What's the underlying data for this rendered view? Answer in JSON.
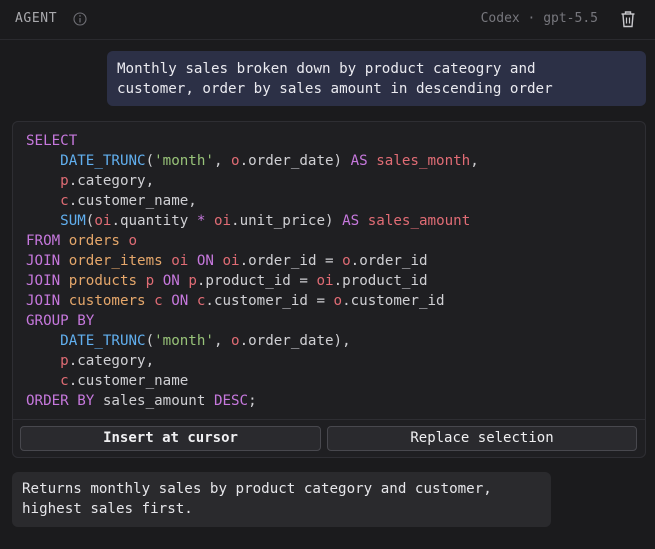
{
  "header": {
    "title": "AGENT",
    "info_icon": "info-circle-icon",
    "model": "Codex · gpt-5.5",
    "delete_icon": "trash-icon"
  },
  "user_message": "Monthly sales broken down by product cateogry and\ncustomer, order by sales amount in descending order",
  "code": {
    "language": "sql",
    "lines": [
      [
        [
          "kw",
          "SELECT"
        ]
      ],
      [
        [
          "sp",
          "    "
        ],
        [
          "fn",
          "DATE_TRUNC"
        ],
        [
          "ident",
          "("
        ],
        [
          "str",
          "'month'"
        ],
        [
          "ident",
          ", "
        ],
        [
          "al",
          "o"
        ],
        [
          "ident",
          ".order_date) "
        ],
        [
          "kw",
          "AS"
        ],
        [
          "ident",
          " "
        ],
        [
          "al",
          "sales_month"
        ],
        [
          "ident",
          ","
        ]
      ],
      [
        [
          "sp",
          "    "
        ],
        [
          "al",
          "p"
        ],
        [
          "ident",
          ".category,"
        ]
      ],
      [
        [
          "sp",
          "    "
        ],
        [
          "al",
          "c"
        ],
        [
          "ident",
          ".customer_name,"
        ]
      ],
      [
        [
          "sp",
          "    "
        ],
        [
          "fn",
          "SUM"
        ],
        [
          "ident",
          "("
        ],
        [
          "al",
          "oi"
        ],
        [
          "ident",
          ".quantity "
        ],
        [
          "kw",
          "*"
        ],
        [
          "ident",
          " "
        ],
        [
          "al",
          "oi"
        ],
        [
          "ident",
          ".unit_price) "
        ],
        [
          "kw",
          "AS"
        ],
        [
          "ident",
          " "
        ],
        [
          "al",
          "sales_amount"
        ]
      ],
      [
        [
          "kw",
          "FROM"
        ],
        [
          "ident",
          " "
        ],
        [
          "tb",
          "orders"
        ],
        [
          "ident",
          " "
        ],
        [
          "al",
          "o"
        ]
      ],
      [
        [
          "kw",
          "JOIN"
        ],
        [
          "ident",
          " "
        ],
        [
          "tb",
          "order_items"
        ],
        [
          "ident",
          " "
        ],
        [
          "al",
          "oi"
        ],
        [
          "ident",
          " "
        ],
        [
          "kw",
          "ON"
        ],
        [
          "ident",
          " "
        ],
        [
          "al",
          "oi"
        ],
        [
          "ident",
          ".order_id = "
        ],
        [
          "al",
          "o"
        ],
        [
          "ident",
          ".order_id"
        ]
      ],
      [
        [
          "kw",
          "JOIN"
        ],
        [
          "ident",
          " "
        ],
        [
          "tb",
          "products"
        ],
        [
          "ident",
          " "
        ],
        [
          "al",
          "p"
        ],
        [
          "ident",
          " "
        ],
        [
          "kw",
          "ON"
        ],
        [
          "ident",
          " "
        ],
        [
          "al",
          "p"
        ],
        [
          "ident",
          ".product_id = "
        ],
        [
          "al",
          "oi"
        ],
        [
          "ident",
          ".product_id"
        ]
      ],
      [
        [
          "kw",
          "JOIN"
        ],
        [
          "ident",
          " "
        ],
        [
          "tb",
          "customers"
        ],
        [
          "ident",
          " "
        ],
        [
          "al",
          "c"
        ],
        [
          "ident",
          " "
        ],
        [
          "kw",
          "ON"
        ],
        [
          "ident",
          " "
        ],
        [
          "al",
          "c"
        ],
        [
          "ident",
          ".customer_id = "
        ],
        [
          "al",
          "o"
        ],
        [
          "ident",
          ".customer_id"
        ]
      ],
      [
        [
          "kw",
          "GROUP BY"
        ]
      ],
      [
        [
          "sp",
          "    "
        ],
        [
          "fn",
          "DATE_TRUNC"
        ],
        [
          "ident",
          "("
        ],
        [
          "str",
          "'month'"
        ],
        [
          "ident",
          ", "
        ],
        [
          "al",
          "o"
        ],
        [
          "ident",
          ".order_date),"
        ]
      ],
      [
        [
          "sp",
          "    "
        ],
        [
          "al",
          "p"
        ],
        [
          "ident",
          ".category,"
        ]
      ],
      [
        [
          "sp",
          "    "
        ],
        [
          "al",
          "c"
        ],
        [
          "ident",
          ".customer_name"
        ]
      ],
      [
        [
          "kw",
          "ORDER BY"
        ],
        [
          "ident",
          " sales_amount "
        ],
        [
          "kw",
          "DESC"
        ],
        [
          "ident",
          ";"
        ]
      ]
    ]
  },
  "actions": {
    "insert_label": "Insert at cursor",
    "replace_label": "Replace selection"
  },
  "assistant_message": "Returns monthly sales by product category and customer,\nhighest sales first.",
  "colors": {
    "keyword": "#c678dd",
    "function": "#61afef",
    "string": "#98c379",
    "alias": "#e06c75",
    "table": "#e5a76b"
  }
}
